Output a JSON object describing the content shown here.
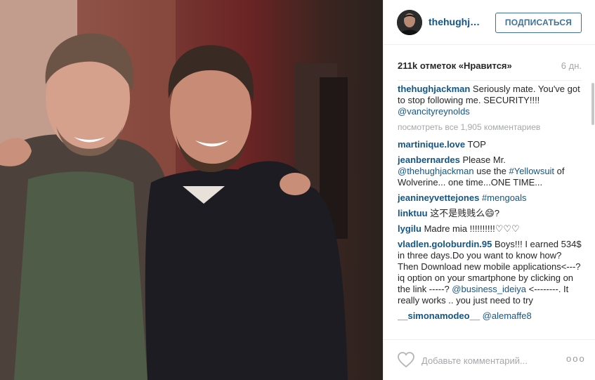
{
  "post": {
    "header": {
      "username": "thehughjackman",
      "follow_label": "ПОДПИСАТЬСЯ"
    },
    "likes_text": "211k отметок «Нравится»",
    "time_ago": "6 дн.",
    "caption": {
      "username": "thehughjackman",
      "text": "Seriously mate. You've got to stop following me. SECURITY!!!! ",
      "mention": "@vancityreynolds"
    },
    "view_all_comments": "посмотреть все 1,905 комментариев",
    "comments": [
      {
        "username": "martinique.love",
        "parts": [
          {
            "t": "TOP",
            "link": false
          }
        ]
      },
      {
        "username": "jeanbernardes",
        "parts": [
          {
            "t": "Please Mr. ",
            "link": false
          },
          {
            "t": "@thehughjackman",
            "link": true
          },
          {
            "t": " use the ",
            "link": false
          },
          {
            "t": "#Yellowsuit",
            "link": true
          },
          {
            "t": " of Wolverine... one time...ONE TIME...",
            "link": false
          }
        ]
      },
      {
        "username": "jeanineyvettejones",
        "parts": [
          {
            "t": "#mengoals",
            "link": true
          }
        ]
      },
      {
        "username": "linktuu",
        "parts": [
          {
            "t": "这不是贱贱么😄?",
            "link": false
          }
        ]
      },
      {
        "username": "lygilu",
        "parts": [
          {
            "t": "Madre mia !!!!!!!!!!♡♡♡",
            "link": false
          }
        ]
      },
      {
        "username": "vladlen.goloburdin.95",
        "parts": [
          {
            "t": "Boys!!! I earned 534$ in three days.Do you want to know how? Then Download new mobile applications<---? iq option on your smartphone by clicking on the link -----? ",
            "link": false
          },
          {
            "t": "@business_ideiya",
            "link": true
          },
          {
            "t": " <--------. It really works .. you just need to try",
            "link": false
          }
        ]
      },
      {
        "username": "__simonamodeo__",
        "parts": [
          {
            "t": "@alemaffe8",
            "link": true
          }
        ]
      }
    ],
    "footer": {
      "comment_placeholder": "Добавьте комментарий...",
      "more_label": "ooo"
    }
  },
  "colors": {
    "username_link": "#125688",
    "follow_border": "#3f729b",
    "muted_text": "#a5a7aa"
  },
  "icons": {
    "heart": "heart-outline-icon",
    "more": "more-options-icon"
  }
}
